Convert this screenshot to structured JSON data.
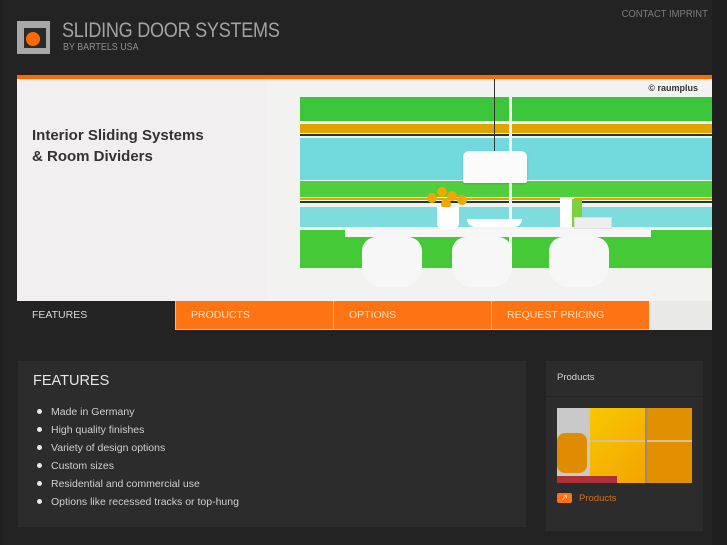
{
  "header": {
    "brand_title": "SLIDING DOOR SYSTEMS",
    "brand_subtitle": "BY BARTELS USA",
    "top_links": [
      "CONTACT",
      "IMPRINT"
    ]
  },
  "hero": {
    "title_line1": "Interior Sliding Systems",
    "title_line2": "& Room Dividers",
    "credit": "© raumplus",
    "stripe_colors": [
      "#39c43a",
      "#e2a300",
      "#6fd8dc",
      "#4ccf3a",
      "#e2a300",
      "#7ddde0",
      "#44c836"
    ]
  },
  "nav": {
    "items": [
      {
        "label": "FEATURES",
        "active": true
      },
      {
        "label": "PRODUCTS",
        "active": false
      },
      {
        "label": "OPTIONS",
        "active": false
      },
      {
        "label": "REQUEST PRICING",
        "active": false
      }
    ]
  },
  "features": {
    "heading": "FEATURES",
    "items": [
      "Made in Germany",
      "High quality finishes",
      "Variety of design options",
      "Custom sizes",
      "Residential and commercial use",
      "Options like recessed tracks or top-hung"
    ]
  },
  "sidebar": {
    "heading": "Products",
    "link_label": "Products",
    "link_icon": "arrow-icon"
  },
  "colors": {
    "accent": "#ff7412",
    "background": "#232323",
    "panel": "#2c2c2c"
  }
}
